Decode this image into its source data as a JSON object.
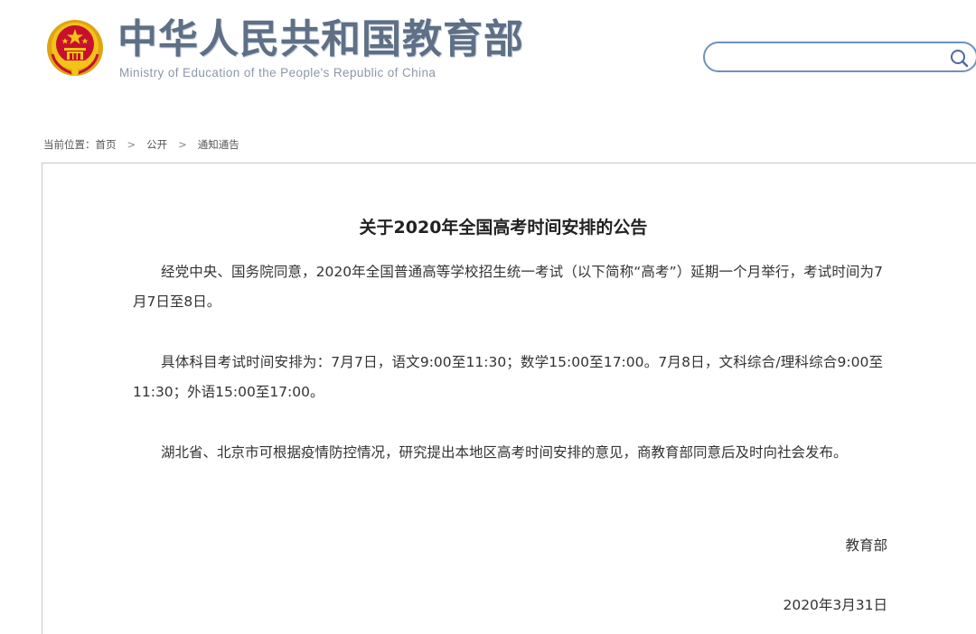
{
  "header": {
    "site_name_cn": "中华人民共和国教育部",
    "site_name_en": "Ministry of Education of the People's Republic of China",
    "emblem_icon": "national-emblem-icon"
  },
  "search": {
    "value": "",
    "placeholder": "",
    "icon": "search-icon",
    "border_color": "#6f8fc1"
  },
  "breadcrumb": {
    "prefix": "当前位置：",
    "items": [
      "首页",
      "公开",
      "通知通告"
    ],
    "separator": ">"
  },
  "article": {
    "title": "关于2020年全国高考时间安排的公告",
    "paragraphs": [
      "经党中央、国务院同意，2020年全国普通高等学校招生统一考试（以下简称“高考”）延期一个月举行，考试时间为7月7日至8日。",
      "具体科目考试时间安排为：7月7日，语文9:00至11:30；数学15:00至17:00。7月8日，文科综合/理科综合9:00至11:30；外语15:00至17:00。",
      "湖北省、北京市可根据疫情防控情况，研究提出本地区高考时间安排的意见，商教育部同意后及时向社会发布。"
    ],
    "signature": "教育部",
    "date": "2020年3月31日"
  },
  "colors": {
    "brand_text": "#5e6f86",
    "emblem_red": "#c8102e",
    "emblem_gold": "#f2c318"
  }
}
